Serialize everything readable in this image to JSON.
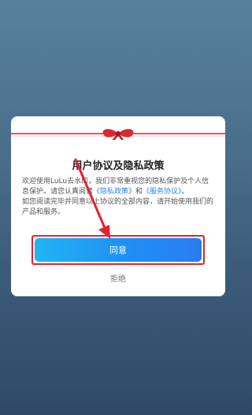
{
  "dialog": {
    "title": "用户协议及隐私政策",
    "intro": "欢迎使用LuLu去水印，我们非常重视您的隐私保护及个人信息保护。请您认真阅读",
    "privacy_link": "《隐私政策》",
    "and_text": "和",
    "service_link": "《服务协议》",
    "period": "。",
    "second_paragraph": "如您阅读完毕并同意以上协议的全部内容，请开始使用我们的产品和服务。",
    "agree_label": "同意",
    "refuse_label": "拒绝"
  },
  "colors": {
    "accent_link": "#2a86e6",
    "button_start": "#22b4f3",
    "button_end": "#2a7cf0",
    "highlight_border": "#e5222f",
    "ribbon": "#d4242b"
  },
  "icons": [
    "bow-icon",
    "annotation-arrow"
  ]
}
